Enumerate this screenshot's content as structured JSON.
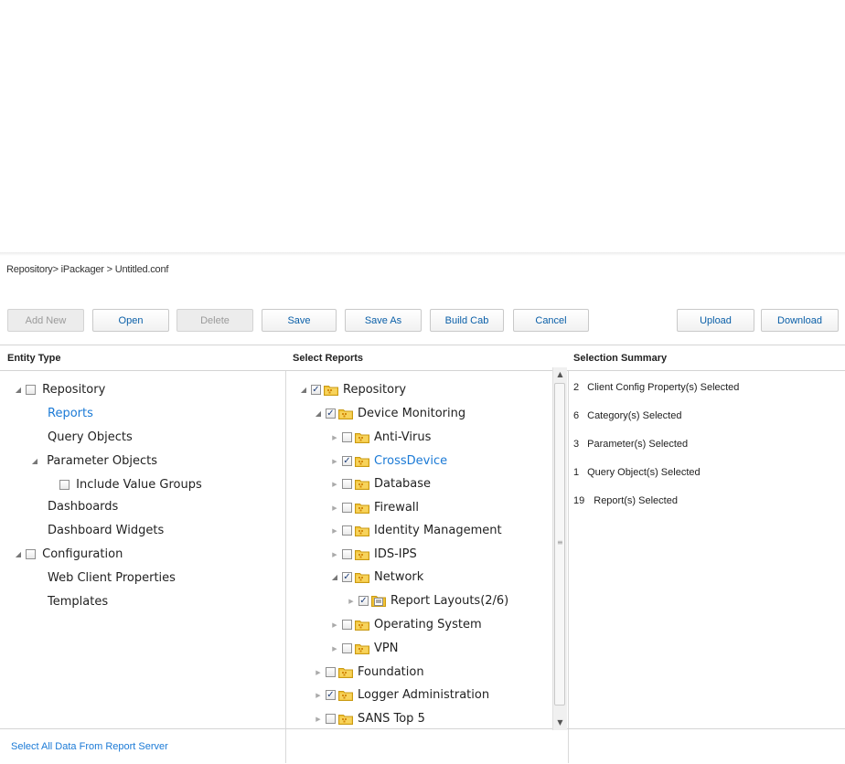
{
  "breadcrumb": "Repository> iPackager > Untitled.conf",
  "toolbar": {
    "add_new": "Add New",
    "open": "Open",
    "delete": "Delete",
    "save": "Save",
    "save_as": "Save As",
    "build_cab": "Build Cab",
    "cancel": "Cancel",
    "upload": "Upload",
    "download": "Download"
  },
  "entity_type": {
    "header": "Entity Type",
    "items": [
      {
        "label": "Repository"
      },
      {
        "label": "Reports"
      },
      {
        "label": "Query Objects"
      },
      {
        "label": "Parameter Objects"
      },
      {
        "label": "Include Value Groups"
      },
      {
        "label": "Dashboards"
      },
      {
        "label": "Dashboard Widgets"
      },
      {
        "label": "Configuration"
      },
      {
        "label": "Web Client Properties"
      },
      {
        "label": "Templates"
      }
    ],
    "footer_link": "Select All Data From Report Server"
  },
  "select_reports": {
    "header": "Select Reports",
    "items": [
      {
        "label": "Repository",
        "checked": true
      },
      {
        "label": "Device Monitoring",
        "checked": true
      },
      {
        "label": "Anti-Virus",
        "checked": false
      },
      {
        "label": "CrossDevice",
        "checked": true
      },
      {
        "label": "Database",
        "checked": false
      },
      {
        "label": "Firewall",
        "checked": false
      },
      {
        "label": "Identity Management",
        "checked": false
      },
      {
        "label": "IDS-IPS",
        "checked": false
      },
      {
        "label": "Network",
        "checked": true
      },
      {
        "label": "Report Layouts(2/6)",
        "checked": true
      },
      {
        "label": "Operating System",
        "checked": false
      },
      {
        "label": "VPN",
        "checked": false
      },
      {
        "label": "Foundation",
        "checked": false
      },
      {
        "label": "Logger Administration",
        "checked": true
      },
      {
        "label": "SANS Top 5",
        "checked": false
      }
    ]
  },
  "selection_summary": {
    "header": "Selection Summary",
    "items": [
      {
        "count": "2",
        "text": "Client Config Property(s) Selected"
      },
      {
        "count": "6",
        "text": "Category(s) Selected"
      },
      {
        "count": "3",
        "text": "Parameter(s) Selected"
      },
      {
        "count": "1",
        "text": "Query Object(s) Selected"
      },
      {
        "count": "19",
        "text": "Report(s) Selected"
      }
    ]
  },
  "colors": {
    "link": "#1b7ad6",
    "button_text": "#0a5fa8",
    "disabled_text": "#9a9a9a",
    "folder": "#f2c233"
  },
  "icons": {
    "expanded": "triangle-down-right",
    "collapsed": "triangle-right",
    "folder": "folder-icon",
    "report": "report-layout-icon",
    "checkbox": "checkbox"
  }
}
